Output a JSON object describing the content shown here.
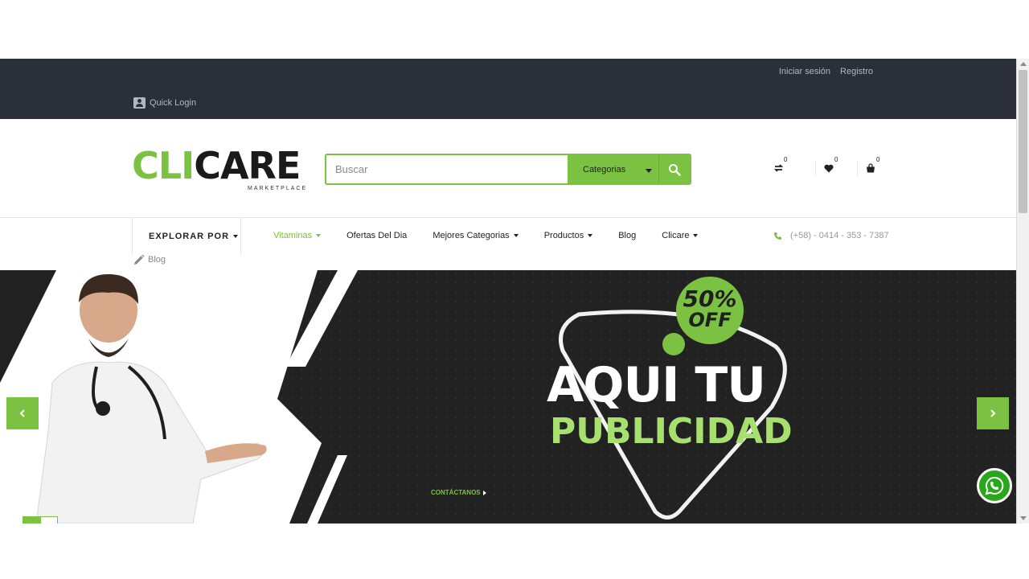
{
  "topbar": {
    "links": [
      "Iniciar sesión",
      "Registro"
    ],
    "quick_login": "Quick Login"
  },
  "logo": {
    "part1": "CLI",
    "part2": "C",
    "part3": "ARE",
    "sub": "MARKETPLACE"
  },
  "search": {
    "placeholder": "Buscar",
    "category": "Categorias"
  },
  "icons": {
    "compare_count": "0",
    "wishlist_count": "0",
    "cart_count": "0"
  },
  "nav": {
    "explore": "EXPLORAR POR",
    "items": [
      {
        "label": "Vitaminas",
        "dropdown": true,
        "active": true
      },
      {
        "label": "Ofertas Del Dia",
        "dropdown": false
      },
      {
        "label": "Mejores Categorias",
        "dropdown": true
      },
      {
        "label": "Productos",
        "dropdown": true
      },
      {
        "label": "Blog",
        "dropdown": false
      },
      {
        "label": "Clicare",
        "dropdown": true
      }
    ],
    "phone": "(+58) - 0414 - 353 - 7387",
    "blog_sub": "Blog"
  },
  "hero": {
    "badge_line1": "50%",
    "badge_line2": "OFF",
    "headline1": "AQUI TU",
    "headline2": "PUBLICIDAD",
    "cta": "CONTÁCTANOS"
  },
  "colors": {
    "accent": "#7cc242",
    "topbar": "#2b2f38",
    "hero_bg": "#222222"
  }
}
